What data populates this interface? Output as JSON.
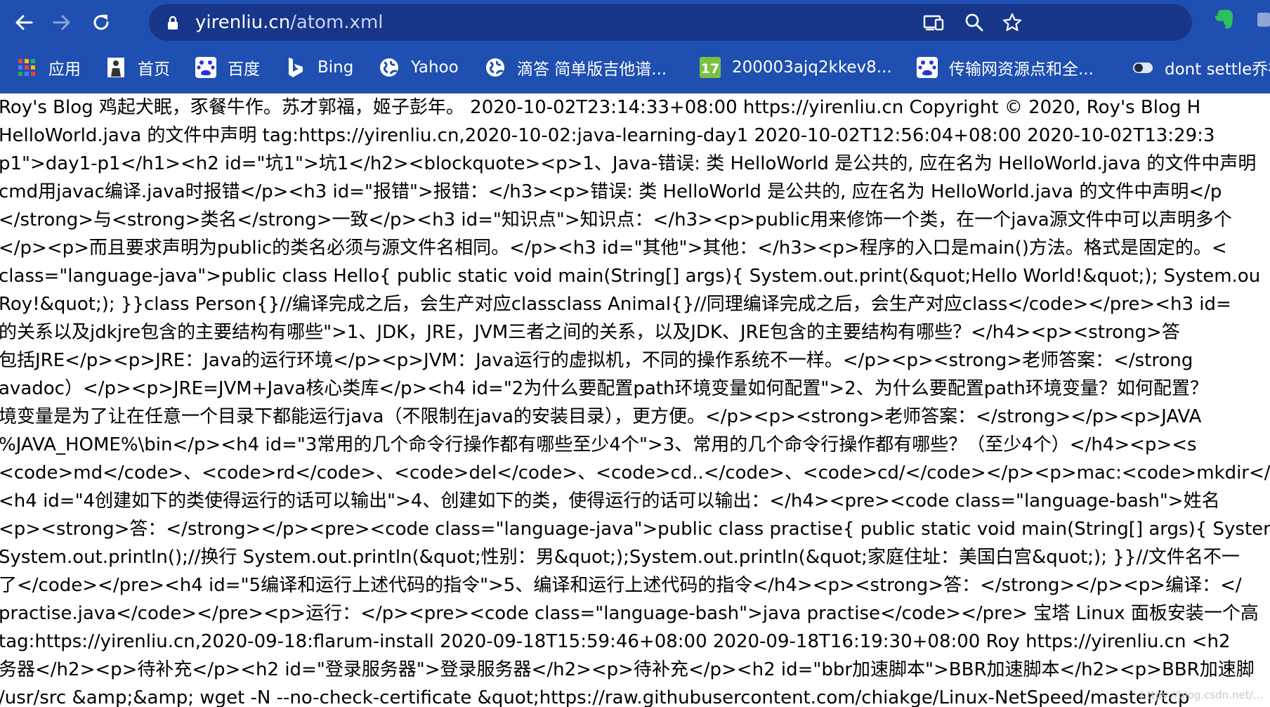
{
  "browser": {
    "url_host": "yirenliu.cn",
    "url_path": "/atom.xml",
    "icons": {
      "back": "back-arrow-icon",
      "forward": "forward-arrow-icon",
      "reload": "reload-icon",
      "lock": "lock-icon",
      "cast": "cast-icon",
      "zoom": "zoom-icon",
      "bookmark": "star-icon",
      "evernote": "evernote-icon"
    },
    "colors": {
      "chrome_bg": "#1f4fb0",
      "omnibox_bg": "#17368a"
    }
  },
  "bookmarks": [
    {
      "label": "应用",
      "icon": "apps-grid-icon"
    },
    {
      "label": "首页",
      "icon": "portrait-icon"
    },
    {
      "label": "百度",
      "icon": "baidu-paw-icon"
    },
    {
      "label": "Bing",
      "icon": "bing-icon"
    },
    {
      "label": "Yahoo",
      "icon": "globe-icon"
    },
    {
      "label": "滴答 简单版吉他谱...",
      "icon": "globe-icon"
    },
    {
      "label": "200003ajq2kkev8...",
      "icon": "number-17-icon"
    },
    {
      "label": "传输网资源点和全...",
      "icon": "baidu-paw-icon"
    },
    {
      "label": "dont settle乔布...",
      "icon": "toggle-icon"
    }
  ],
  "content": {
    "lines": [
      "Roy's Blog 鸡起犬眠，豕餐牛作。苏才郭福，姬子彭年。 2020-10-02T23:14:33+08:00 https://yirenliu.cn Copyright © 2020, Roy's Blog H",
      "HelloWorld.java 的文件中声明 tag:https://yirenliu.cn,2020-10-02:java-learning-day1 2020-10-02T12:56:04+08:00 2020-10-02T13:29:3",
      "p1\">day1-p1</h1><h2 id=\"坑1\">坑1</h2><blockquote><p>1、Java-错误: 类 HelloWorld 是公共的, 应在名为 HelloWorld.java 的文件中声明",
      "cmd用javac编译.java时报错</p><h3 id=\"报错\">报错：</h3><p>错误: 类 HelloWorld 是公共的, 应在名为 HelloWorld.java 的文件中声明</p",
      "</strong>与<strong>类名</strong>一致</p><h3 id=\"知识点\">知识点：</h3><p>public用来修饰一个类，在一个java源文件中可以声明多个",
      "</p><p>而且要求声明为public的类名必须与源文件名相同。</p><h3 id=\"其他\">其他：</h3><p>程序的入口是main()方法。格式是固定的。<",
      "class=\"language-java\">public class Hello{ public static void main(String[] args){ System.out.print(&quot;Hello World!&quot;); System.ou",
      "Roy!&quot;); }}class Person{}//编译完成之后，会生产对应classclass Animal{}//同理编译完成之后，会生产对应class</code></pre><h3 id=",
      "的关系以及jdkjre包含的主要结构有哪些\">1、JDK，JRE，JVM三者之间的关系，以及JDK、JRE包含的主要结构有哪些？</h4><p><strong>答",
      "包括JRE</p><p>JRE：Java的运行环境</p><p>JVM：Java运行的虚拟机，不同的操作系统不一样。</p><p><strong>老师答案：</strong",
      "avadoc）</p><p>JRE=JVM+Java核心类库</p><h4 id=\"2为什么要配置path环境变量如何配置\">2、为什么要配置path环境变量？如何配置？",
      "境变量是为了让在任意一个目录下都能运行java（不限制在java的安装目录），更方便。</p><p><strong>老师答案：</strong></p><p>JAVA",
      "%JAVA_HOME%\\bin</p><h4 id=\"3常用的几个命令行操作都有哪些至少4个\">3、常用的几个命令行操作都有哪些？（至少4个）</h4><p><s",
      "<code>md</code>、<code>rd</code>、<code>del</code>、<code>cd..</code>、<code>cd/</code></p><p>mac:<code>mkdir</",
      "<h4 id=\"4创建如下的类使得运行的话可以输出\">4、创建如下的类，使得运行的话可以输出：</h4><pre><code class=\"language-bash\">姓名",
      "<p><strong>答：</strong></p><pre><code class=\"language-java\">public class practise{ public static void main(String[] args){ System",
      "System.out.println();//换行 System.out.println(&quot;性别：男&quot;);System.out.println(&quot;家庭住址：美国白宫&quot;); }}//文件名不一",
      "了</code></pre><h4 id=\"5编译和运行上述代码的指令\">5、编译和运行上述代码的指令</h4><p><strong>答：</strong></p><p>编译：</",
      "practise.java</code></pre><p>运行：</p><pre><code class=\"language-bash\">java practise</code></pre> 宝塔 Linux 面板安装一个高",
      "tag:https://yirenliu.cn,2020-09-18:flarum-install 2020-09-18T15:59:46+08:00 2020-09-18T16:19:30+08:00 Roy https://yirenliu.cn <h2",
      "务器</h2><p>待补充</p><h2 id=\"登录服务器\">登录服务器</h2><p>待补充</p><h2 id=\"bbr加速脚本\">BBR加速脚本</h2><p>BBR加速脚",
      "/usr/src &amp;&amp; wget -N --no-check-certificate &quot;https://raw.githubusercontent.com/chiakge/Linux-NetSpeed/master/tcp"
    ],
    "watermark": "https://blog.csdn.net/..."
  }
}
